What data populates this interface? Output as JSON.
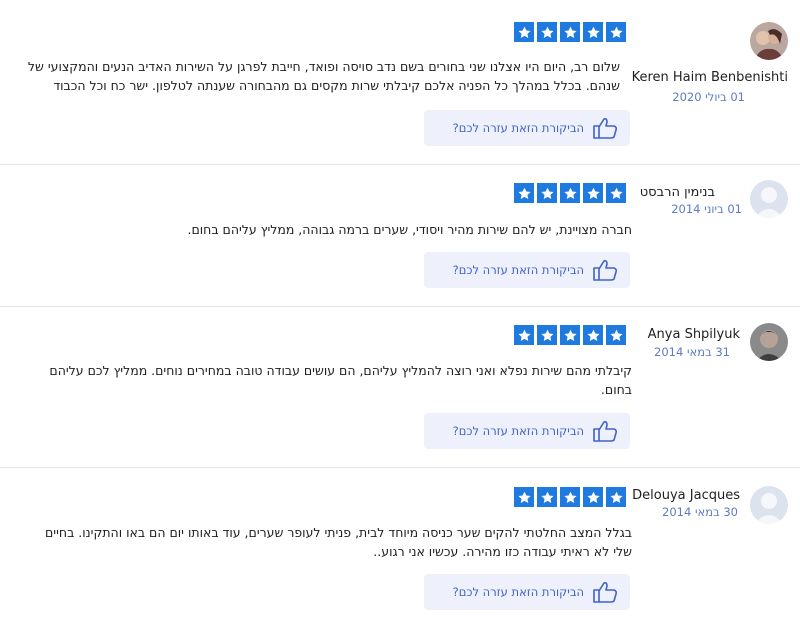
{
  "helpful_label": "הביקורת הזאת עזרה לכם?",
  "accent_color": "#1f7ae0",
  "reviews": [
    {
      "author": "Keren Haim Benbenishti",
      "date": "01 ביולי 2020",
      "rating": 5,
      "avatar": "photo",
      "text_lines": [
        "שלום רב, היום היו אצלנו שני בחורים בשם נדב סויסה ופואד, חייבת לפרגן על השירות האדיב הנעים והמקצועי של",
        "שנהם. בכלל במהלך כל הפניה אלכם קיבלתי שרות מקסים גם מהבחורה שענתה לטלפון. ישר כח וכל הכבוד"
      ]
    },
    {
      "author": "בנימין הרבסט",
      "date": "01 ביוני 2014",
      "rating": 5,
      "avatar": "placeholder",
      "text_lines": [
        "חברה מצויינת, יש להם שירות מהיר ויסודי, שערים ברמה גבוהה, ממליץ עליהם בחום."
      ]
    },
    {
      "author": "Anya Shpilyuk",
      "date": "31 במאי 2014",
      "rating": 5,
      "avatar": "photo",
      "text_lines": [
        "קיבלתי מהם שירות נפלא ואני רוצה להמליץ עליהם, הם עושים עבודה טובה במחירים נוחים. ממליץ לכם עליהם",
        "בחום."
      ]
    },
    {
      "author": "Delouya Jacques",
      "date": "30 במאי 2014",
      "rating": 5,
      "avatar": "placeholder",
      "text_lines": [
        "בגלל המצב החלטתי להקים שער כניסה מיוחד לבית, פניתי לעופר שערים, עוד באותו יום הם באו והתקינו. בחיים",
        "שלי לא ראיתי עבודה כזו מהירה. עכשיו אני רגוע.."
      ]
    }
  ]
}
